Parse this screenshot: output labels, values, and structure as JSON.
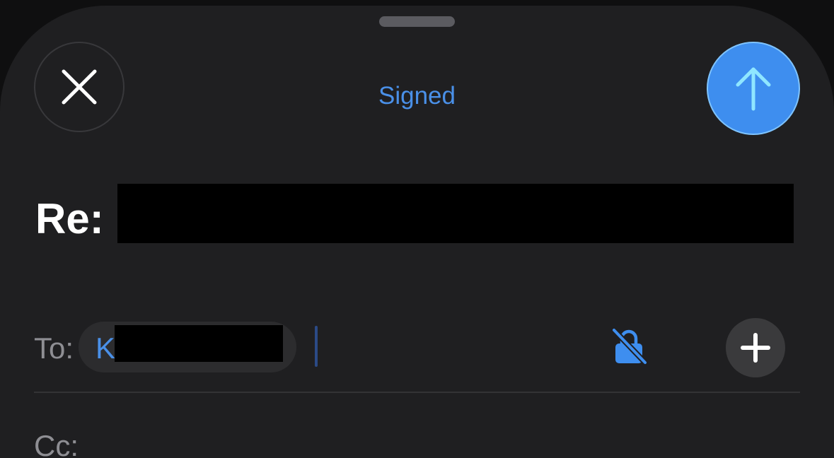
{
  "header": {
    "title": "Signed",
    "close_icon": "close-icon",
    "send_icon": "arrow-up-icon"
  },
  "subject": {
    "prefix": "Re:"
  },
  "to": {
    "label": "To:",
    "recipient_visible": "K"
  },
  "cc": {
    "label": "Cc:"
  },
  "colors": {
    "accent": "#4a90e8",
    "send_button": "#3e8eef",
    "background": "#1f1f21"
  }
}
